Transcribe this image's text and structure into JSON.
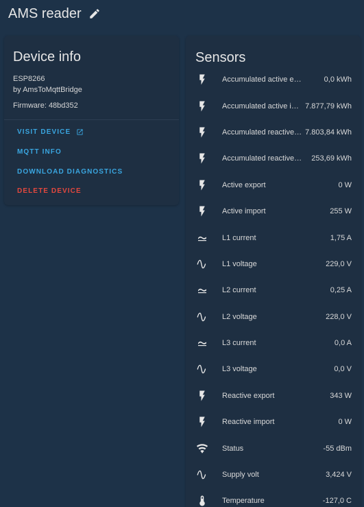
{
  "header": {
    "title": "AMS reader",
    "edit_icon": "pencil-icon"
  },
  "device_info": {
    "title": "Device info",
    "model": "ESP8266",
    "manufacturer": "by AmsToMqttBridge",
    "firmware": "Firmware: 48bd352",
    "actions": {
      "visit": "VISIT DEVICE",
      "mqtt": "MQTT INFO",
      "diagnostics": "DOWNLOAD DIAGNOSTICS",
      "delete": "DELETE DEVICE"
    }
  },
  "colors": {
    "accent": "#3aa6e0",
    "danger": "#e3483e",
    "background": "#1d3248",
    "card": "#1e2f42"
  },
  "sensors": {
    "title": "Sensors",
    "items": [
      {
        "name": "Accumulated active export",
        "value": "0,0 kWh",
        "icon": "flash-icon"
      },
      {
        "name": "Accumulated active import",
        "value": "7.877,79 kWh",
        "icon": "flash-icon"
      },
      {
        "name": "Accumulated reactive export",
        "value": "7.803,84 kWh",
        "icon": "flash-icon"
      },
      {
        "name": "Accumulated reactive import",
        "value": "253,69 kWh",
        "icon": "flash-icon"
      },
      {
        "name": "Active export",
        "value": "0 W",
        "icon": "flash-icon"
      },
      {
        "name": "Active import",
        "value": "255 W",
        "icon": "flash-icon"
      },
      {
        "name": "L1 current",
        "value": "1,75 A",
        "icon": "current-ac-icon"
      },
      {
        "name": "L1 voltage",
        "value": "229,0 V",
        "icon": "sine-wave-icon"
      },
      {
        "name": "L2 current",
        "value": "0,25 A",
        "icon": "current-ac-icon"
      },
      {
        "name": "L2 voltage",
        "value": "228,0 V",
        "icon": "sine-wave-icon"
      },
      {
        "name": "L3 current",
        "value": "0,0 A",
        "icon": "current-ac-icon"
      },
      {
        "name": "L3 voltage",
        "value": "0,0 V",
        "icon": "sine-wave-icon"
      },
      {
        "name": "Reactive export",
        "value": "343 W",
        "icon": "flash-icon"
      },
      {
        "name": "Reactive import",
        "value": "0 W",
        "icon": "flash-icon"
      },
      {
        "name": "Status",
        "value": "-55 dBm",
        "icon": "wifi-icon"
      },
      {
        "name": "Supply volt",
        "value": "3,424 V",
        "icon": "sine-wave-icon"
      },
      {
        "name": "Temperature",
        "value": "-127,0 C",
        "icon": "thermometer-icon"
      }
    ]
  }
}
